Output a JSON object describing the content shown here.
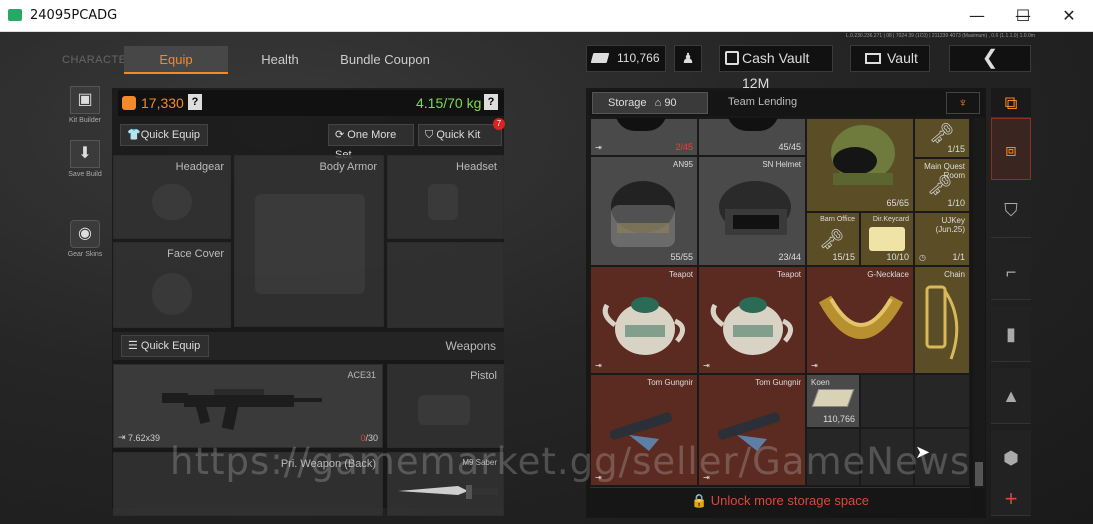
{
  "window": {
    "title": "24095PCADG",
    "minimize": "—",
    "maximize": "☐",
    "close": "✕"
  },
  "nav": {
    "character_label": "CHARACTER",
    "tabs": [
      "Equip",
      "Health",
      "Bundle Coupon"
    ]
  },
  "top": {
    "money": "110,766",
    "cash_vault": "Cash Vault 12M",
    "vault": "Vault",
    "status_line": "L.0.230.236.271 | 08 | 7024 39 (1C0) | 211239 4073 (Maximum) , 0.6 (1.1.1.0) 1.0.0m"
  },
  "sidebar": [
    {
      "label": "Kit Builder",
      "icon": "vest-icon"
    },
    {
      "label": "Save Build",
      "icon": "download-icon"
    },
    {
      "label": "Gear Skins",
      "icon": "helmet-icon"
    }
  ],
  "equip": {
    "value": "17,330",
    "weight": "4.15/70 kg",
    "help": "?",
    "quick_equip": "Quick Equip",
    "one_more_set": "One More Set",
    "quick_kit": "Quick Kit",
    "quick_kit_badge": "7",
    "slots": {
      "headgear": "Headgear",
      "body_armor": "Body Armor",
      "headset": "Headset",
      "face_cover": "Face Cover"
    },
    "weapons_quick_equip": "Quick Equip",
    "weapons_label": "Weapons",
    "primary_weapon": {
      "name": "ACE31",
      "caliber": "7.62x39",
      "ammo_current": "0",
      "ammo_max": "/30"
    },
    "pistol": "Pistol",
    "pri_back": "Pri. Weapon (Back)",
    "melee": "M9 Saber"
  },
  "storage": {
    "title": "Storage",
    "rows": "90 Rows",
    "team_lending": "Team Lending",
    "unlock": "Unlock more storage space",
    "items": [
      {
        "id": "r0c0",
        "name": "",
        "count": "2/45",
        "count_color": "#e0453a",
        "bg": "grey"
      },
      {
        "id": "r0c1",
        "name": "",
        "count": "45/45",
        "bg": "grey"
      },
      {
        "id": "r1c0",
        "name": "AN95",
        "count": "55/55",
        "bg": "grey"
      },
      {
        "id": "r1c1",
        "name": "SN Helmet",
        "count": "23/44",
        "bg": "grey"
      },
      {
        "id": "helmet-green",
        "name": "",
        "count": "65/65",
        "bg": "gold"
      },
      {
        "id": "key-top",
        "name": "",
        "count": "1/15",
        "bg": "gold"
      },
      {
        "id": "key-main",
        "name": "Main Quest Room",
        "count": "1/10",
        "bg": "gold"
      },
      {
        "id": "barn",
        "name": "Barn Office",
        "count": "15/15",
        "bg": "gold"
      },
      {
        "id": "dir",
        "name": "Dir.Keycard",
        "count": "10/10",
        "bg": "gold"
      },
      {
        "id": "ujkey",
        "name": "UJKey (Jun.25)",
        "count": "1/1",
        "bg": "gold"
      },
      {
        "id": "teapot1",
        "name": "Teapot",
        "count": "",
        "bg": "red"
      },
      {
        "id": "teapot2",
        "name": "Teapot",
        "count": "",
        "bg": "red"
      },
      {
        "id": "gnecklace",
        "name": "G-Necklace",
        "count": "",
        "bg": "red"
      },
      {
        "id": "chain",
        "name": "Chain",
        "count": "",
        "bg": "gold"
      },
      {
        "id": "gungnir1",
        "name": "Tom Gungnir",
        "count": "",
        "bg": "red"
      },
      {
        "id": "gungnir2",
        "name": "Tom Gungnir",
        "count": "",
        "bg": "red"
      },
      {
        "id": "koen",
        "name": "Koen",
        "count": "110,766",
        "bg": "grey"
      }
    ]
  },
  "categories": [
    "all-items-icon",
    "vest-icon",
    "rifle-icon",
    "magazine-icon",
    "bullet-icon",
    "supplies-icon",
    "add-icon"
  ],
  "watermark": "https://gamemarket.gg/seller/GameNews",
  "colors": {
    "accent": "#f28a2c",
    "weight_green": "#7ed957",
    "unlock_red": "#e0453a"
  }
}
